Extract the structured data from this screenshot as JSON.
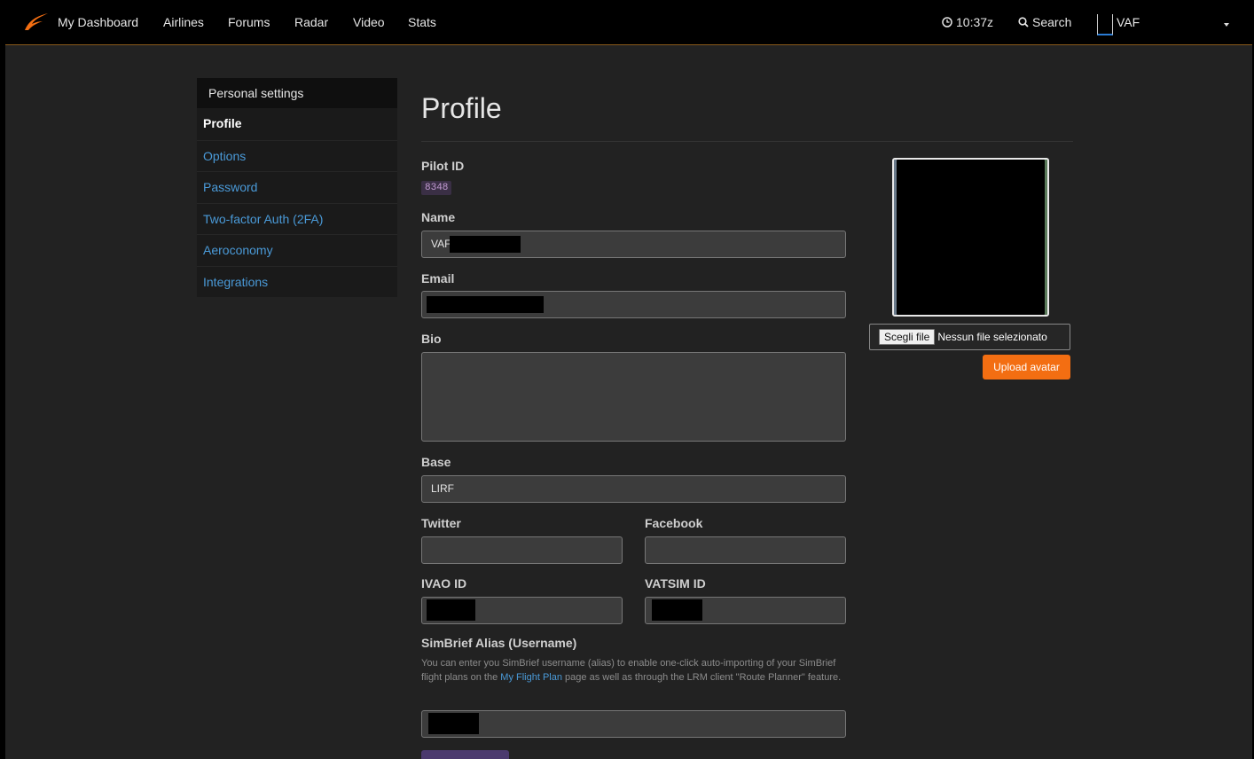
{
  "nav": {
    "items": [
      "My Dashboard",
      "Airlines",
      "Forums",
      "Radar",
      "Video",
      "Stats"
    ],
    "time": "10:37z",
    "search": "Search",
    "user": "VAF"
  },
  "sidebar": {
    "header": "Personal settings",
    "items": [
      "Profile",
      "Options",
      "Password",
      "Two-factor Auth (2FA)",
      "Aeroconomy",
      "Integrations"
    ]
  },
  "page": {
    "title": "Profile",
    "pilot_id_label": "Pilot ID",
    "pilot_id": "8348",
    "name_label": "Name",
    "name_value": "VAF",
    "email_label": "Email",
    "bio_label": "Bio",
    "base_label": "Base",
    "base_value": "LIRF",
    "twitter_label": "Twitter",
    "facebook_label": "Facebook",
    "ivao_label": "IVAO ID",
    "vatsim_label": "VATSIM ID",
    "simbrief_label": "SimBrief Alias (Username)",
    "simbrief_help_pre": "You can enter you SimBrief username (alias) to enable one-click auto-importing of your SimBrief flight plans on the ",
    "simbrief_help_link": "My Flight Plan",
    "simbrief_help_post": " page as well as through the LRM client \"Route Planner\" feature."
  },
  "avatar": {
    "choose_file": "Scegli file",
    "no_file": "Nessun file selezionato",
    "upload": "Upload avatar"
  },
  "colors": {
    "accent": "#f36e12",
    "link": "#4a9ad8",
    "background": "#222222"
  }
}
